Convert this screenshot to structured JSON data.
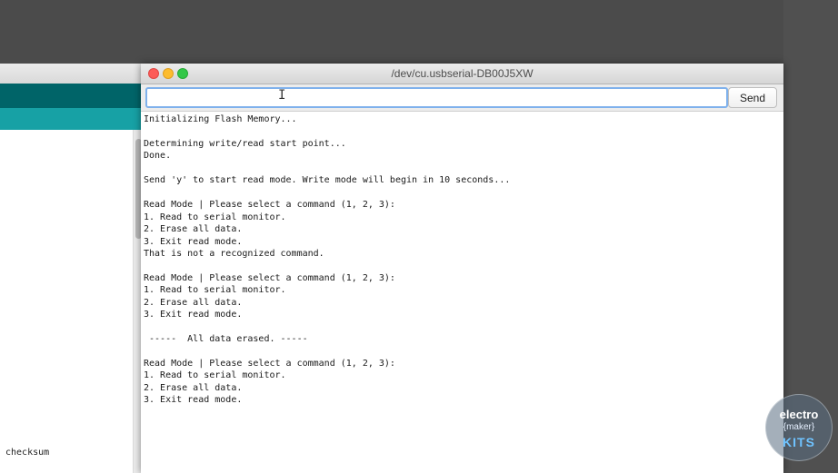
{
  "ide": {
    "status_text": "checksum",
    "toolbar_color": "#006468",
    "tabs_color": "#17a1a5"
  },
  "serial_monitor": {
    "title": "/dev/cu.usbserial-DB00J5XW",
    "input": {
      "value": "",
      "placeholder": ""
    },
    "send_label": "Send",
    "output_lines": [
      "Initializing Flash Memory...",
      "",
      "Determining write/read start point...",
      "Done.",
      "",
      "Send 'y' to start read mode. Write mode will begin in 10 seconds...",
      "",
      "Read Mode | Please select a command (1, 2, 3):",
      "1. Read to serial monitor.",
      "2. Erase all data.",
      "3. Exit read mode.",
      "That is not a recognized command.",
      "",
      "Read Mode | Please select a command (1, 2, 3):",
      "1. Read to serial monitor.",
      "2. Erase all data.",
      "3. Exit read mode.",
      "",
      " -----  All data erased. -----",
      "",
      "Read Mode | Please select a command (1, 2, 3):",
      "1. Read to serial monitor.",
      "2. Erase all data.",
      "3. Exit read mode."
    ]
  },
  "watermark": {
    "line1": "electro",
    "line2": "{maker}",
    "line3": "KITS"
  },
  "icons": {
    "serial_monitor_button": "magnifier-icon",
    "tab_menu": "chevron-down-icon",
    "cursor": "ibeam-cursor-icon"
  }
}
